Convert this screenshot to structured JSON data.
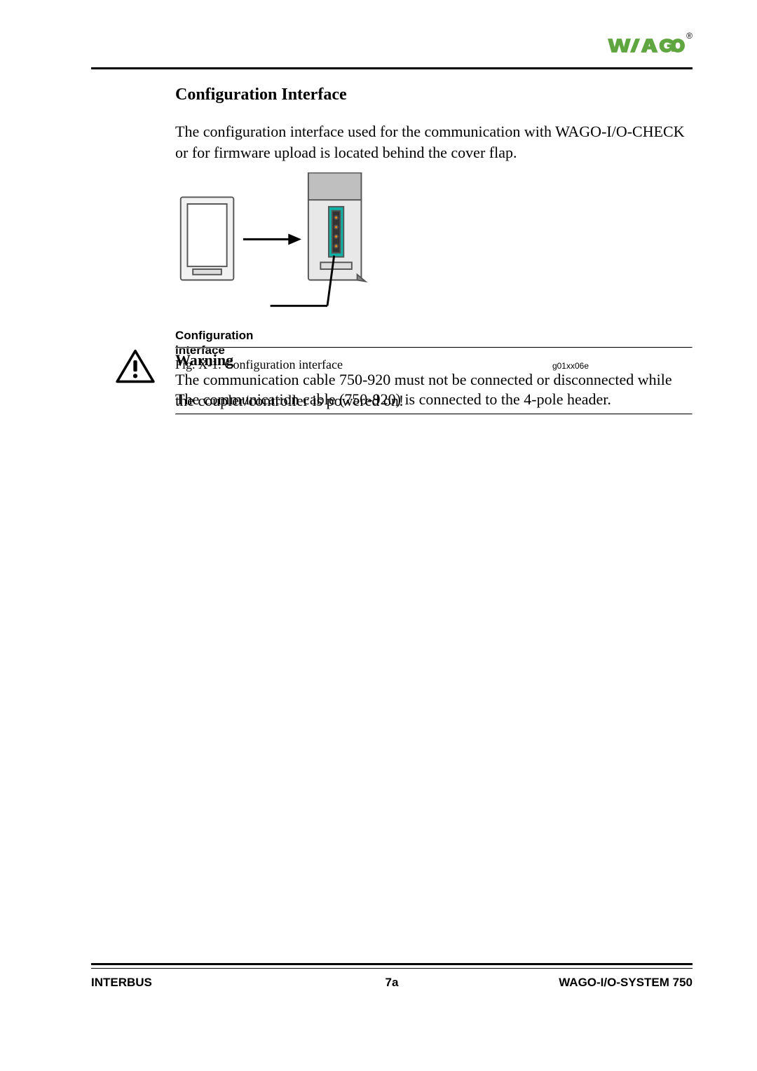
{
  "brand": {
    "name": "WAGO",
    "registered_mark": "®",
    "color": "#5fa641"
  },
  "section": {
    "heading": "Configuration Interface"
  },
  "paragraphs": {
    "intro": "The configuration interface used for the communication with WAGO-I/O-CHECK or for firmware upload is located behind the cover flap.",
    "after_figure": "The communication cable (750-920) is connected to the 4-pole header."
  },
  "figure": {
    "diagram_label_line1": "Configuration",
    "diagram_label_line2": "interface",
    "caption": "Fig. X-1: Configuration interface",
    "code": "g01xx06e"
  },
  "warning": {
    "title": "Warning",
    "text": "The communication cable 750-920 must not be connected or disconnected while the coupler/controller is powered on!"
  },
  "footer": {
    "left": "INTERBUS",
    "center": "7a",
    "right": "WAGO-I/O-SYSTEM 750"
  }
}
